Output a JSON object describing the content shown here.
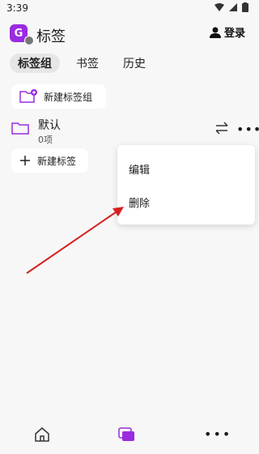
{
  "status_bar": {
    "time": "3:39"
  },
  "header": {
    "avatar_letter": "G",
    "title": "标签",
    "login_label": "登录"
  },
  "tabs": [
    {
      "label": "标签组",
      "active": true
    },
    {
      "label": "书签",
      "active": false
    },
    {
      "label": "历史",
      "active": false
    }
  ],
  "new_group_button": {
    "label": "新建标签组"
  },
  "group": {
    "name": "默认",
    "count": "0项"
  },
  "new_tag_button": {
    "label": "新建标签"
  },
  "context_menu": {
    "items": [
      "编辑",
      "删除"
    ]
  },
  "colors": {
    "accent": "#9a2be0",
    "arrow": "#d62020"
  }
}
